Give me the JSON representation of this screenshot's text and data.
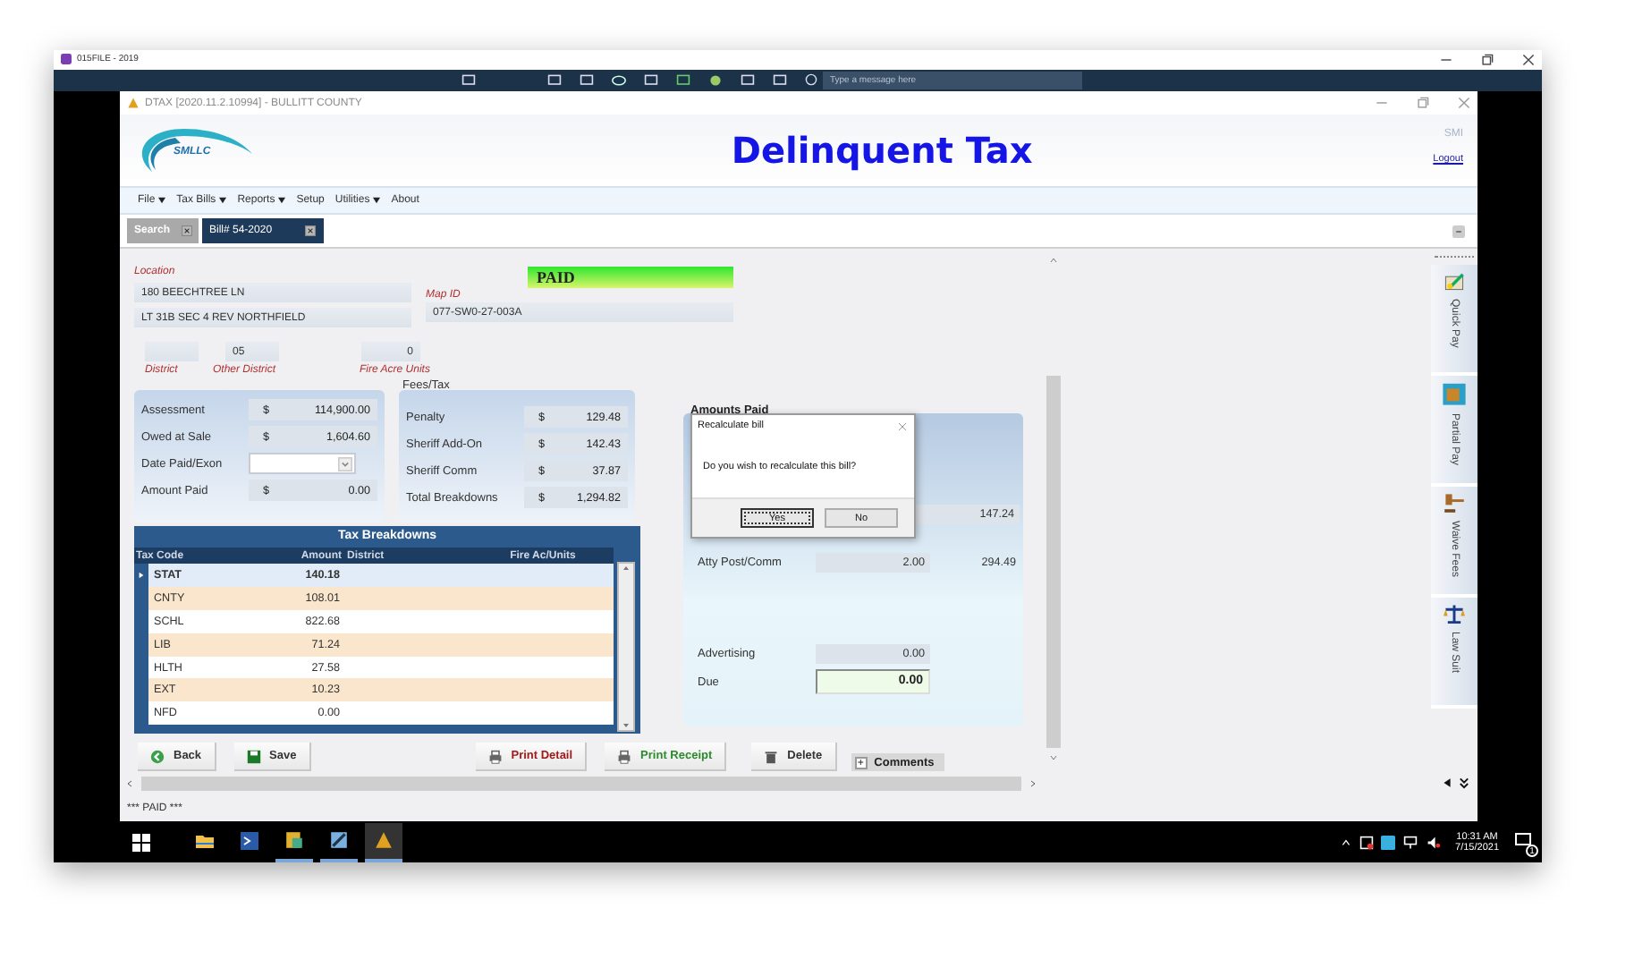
{
  "outer_window": {
    "title": "015FILE - 2019"
  },
  "remote_toolbar": {
    "placeholder": "Type a message here"
  },
  "app": {
    "title": "DTAX [2020.11.2.10994] - BULLITT COUNTY",
    "logo_text": "SMLLC",
    "heading": "Delinquent Tax",
    "user": "SMI",
    "logout": "Logout"
  },
  "menu": [
    {
      "label": "File",
      "dropdown": true
    },
    {
      "label": "Tax Bills",
      "dropdown": true
    },
    {
      "label": "Reports",
      "dropdown": true
    },
    {
      "label": "Setup",
      "dropdown": false
    },
    {
      "label": "Utilities",
      "dropdown": true
    },
    {
      "label": "About",
      "dropdown": false
    }
  ],
  "tabs": [
    {
      "label": "Search",
      "selected": false
    },
    {
      "label": "Bill# 54-2020",
      "selected": true
    }
  ],
  "status_badge": "PAID",
  "location": {
    "label": "Location",
    "line1": "180 BEECHTREE LN",
    "line2": "LT 31B SEC 4 REV NORTHFIELD"
  },
  "map_id": {
    "label": "Map ID",
    "value": "077-SW0-27-003A"
  },
  "district": {
    "label": "District"
  },
  "other_district": {
    "label": "Other District",
    "value": "05"
  },
  "fire_acre_units": {
    "label": "Fire Acre Units",
    "value": "0"
  },
  "assessment": [
    {
      "kind": "money",
      "label": "Assessment",
      "currency": "$",
      "value": "114,900.00"
    },
    {
      "kind": "money",
      "label": "Owed at Sale",
      "currency": "$",
      "value": "1,604.60"
    },
    {
      "kind": "date",
      "label": "Date Paid/Exon"
    },
    {
      "kind": "money",
      "label": "Amount Paid",
      "currency": "$",
      "value": "0.00"
    }
  ],
  "fees": {
    "title": "Fees/Tax",
    "rows": [
      {
        "label": "Penalty",
        "currency": "$",
        "value": "129.48"
      },
      {
        "label": "Sheriff Add-On",
        "currency": "$",
        "value": "142.43"
      },
      {
        "label": "Sheriff Comm",
        "currency": "$",
        "value": "37.87"
      },
      {
        "label": "Total Breakdowns",
        "currency": "$",
        "value": "1,294.82"
      }
    ]
  },
  "amounts_paid": {
    "title": "Amounts Paid",
    "rows": [
      {
        "kind": "row",
        "column_2": "147.24"
      },
      {
        "kind": "row",
        "label": "Atty Post/Comm",
        "column_1": "2.00",
        "column_2": "294.49"
      },
      {
        "kind": "gap"
      },
      {
        "kind": "row",
        "label": "Advertising",
        "column_1": "0.00"
      },
      {
        "kind": "due",
        "label": "Due",
        "column_1": "0.00"
      }
    ]
  },
  "dialog": {
    "title": "Recalculate bill",
    "message": "Do you wish to recalculate this bill?",
    "buttons": [
      {
        "label": "Yes",
        "selected": true
      },
      {
        "label": "No",
        "selected": false
      }
    ]
  },
  "tax_breakdowns": {
    "title": "Tax Breakdowns",
    "columns": [
      "Tax Code",
      "Amount",
      "District",
      "Fire Ac/Units"
    ],
    "rows": [
      {
        "code": "STAT",
        "amount": "140.18",
        "selected": true
      },
      {
        "code": "CNTY",
        "amount": "108.01",
        "selected": false
      },
      {
        "code": "SCHL",
        "amount": "822.68",
        "selected": false
      },
      {
        "code": "LIB",
        "amount": "71.24",
        "selected": false
      },
      {
        "code": "HLTH",
        "amount": "27.58",
        "selected": false
      },
      {
        "code": "EXT",
        "amount": "10.23",
        "selected": false
      },
      {
        "code": "NFD",
        "amount": "0.00",
        "selected": false
      }
    ]
  },
  "actions": [
    {
      "kind": "back",
      "label": "Back"
    },
    {
      "kind": "save",
      "label": "Save"
    },
    {
      "kind": "print_detail",
      "label": "Print Detail"
    },
    {
      "kind": "print_receipt",
      "label": "Print Receipt"
    },
    {
      "kind": "delete",
      "label": "Delete"
    }
  ],
  "comments": {
    "toggle": "+",
    "label": "Comments"
  },
  "side_tabs": [
    {
      "kind": "quick",
      "label": "Quick Pay"
    },
    {
      "kind": "partial",
      "label": "Partial Pay"
    },
    {
      "kind": "waive",
      "label": "Waive Fees"
    },
    {
      "kind": "lawsuit",
      "label": "Law Suit"
    }
  ],
  "status_bar": "*** PAID ***",
  "taskbar": {
    "time": "10:31 AM",
    "date": "7/15/2021",
    "notifications": "1"
  }
}
